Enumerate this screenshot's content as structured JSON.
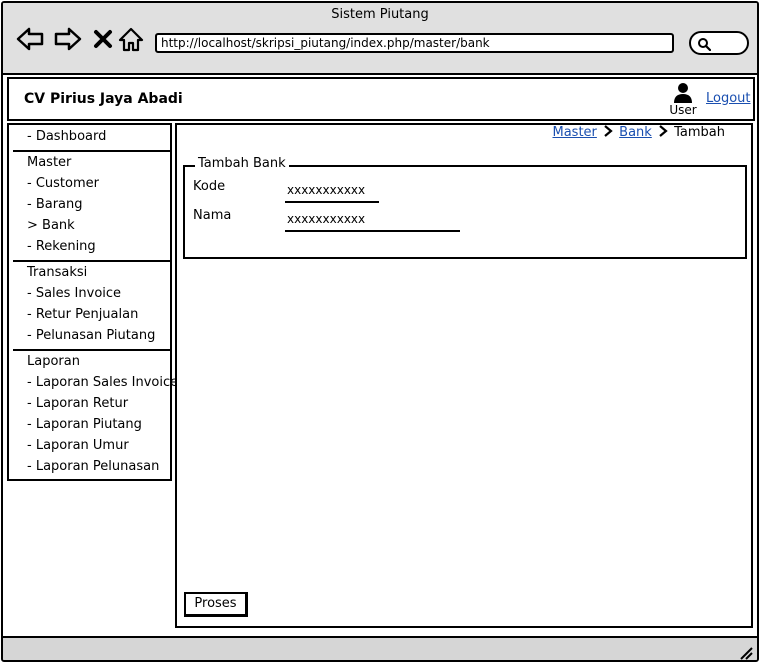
{
  "window": {
    "title": "Sistem Piutang"
  },
  "browser": {
    "url": "http://localhost/skripsi_piutang/index.php/master/bank",
    "icons": [
      "back-arrow-icon",
      "forward-arrow-icon",
      "close-icon",
      "home-icon",
      "search-icon"
    ]
  },
  "header": {
    "company": "CV Pirius Jaya Abadi",
    "user_label": "User",
    "logout_label": "Logout"
  },
  "sidebar": {
    "dashboard": "- Dashboard",
    "master": {
      "heading": "Master",
      "items": [
        "- Customer",
        "- Barang",
        "> Bank",
        "- Rekening"
      ]
    },
    "transaksi": {
      "heading": "Transaksi",
      "items": [
        "- Sales Invoice",
        "- Retur Penjualan",
        "- Pelunasan Piutang"
      ]
    },
    "laporan": {
      "heading": "Laporan",
      "items": [
        "- Laporan Sales Invoice",
        "- Laporan Retur",
        "- Laporan Piutang",
        "- Laporan Umur",
        "- Laporan Pelunasan"
      ]
    }
  },
  "breadcrumb": {
    "items": [
      "Master",
      "Bank"
    ],
    "current": "Tambah"
  },
  "form": {
    "legend": "Tambah Bank",
    "fields": [
      {
        "label": "Kode",
        "value": "xxxxxxxxxxx"
      },
      {
        "label": "Nama",
        "value": "xxxxxxxxxxx"
      }
    ],
    "submit_label": "Proses"
  }
}
